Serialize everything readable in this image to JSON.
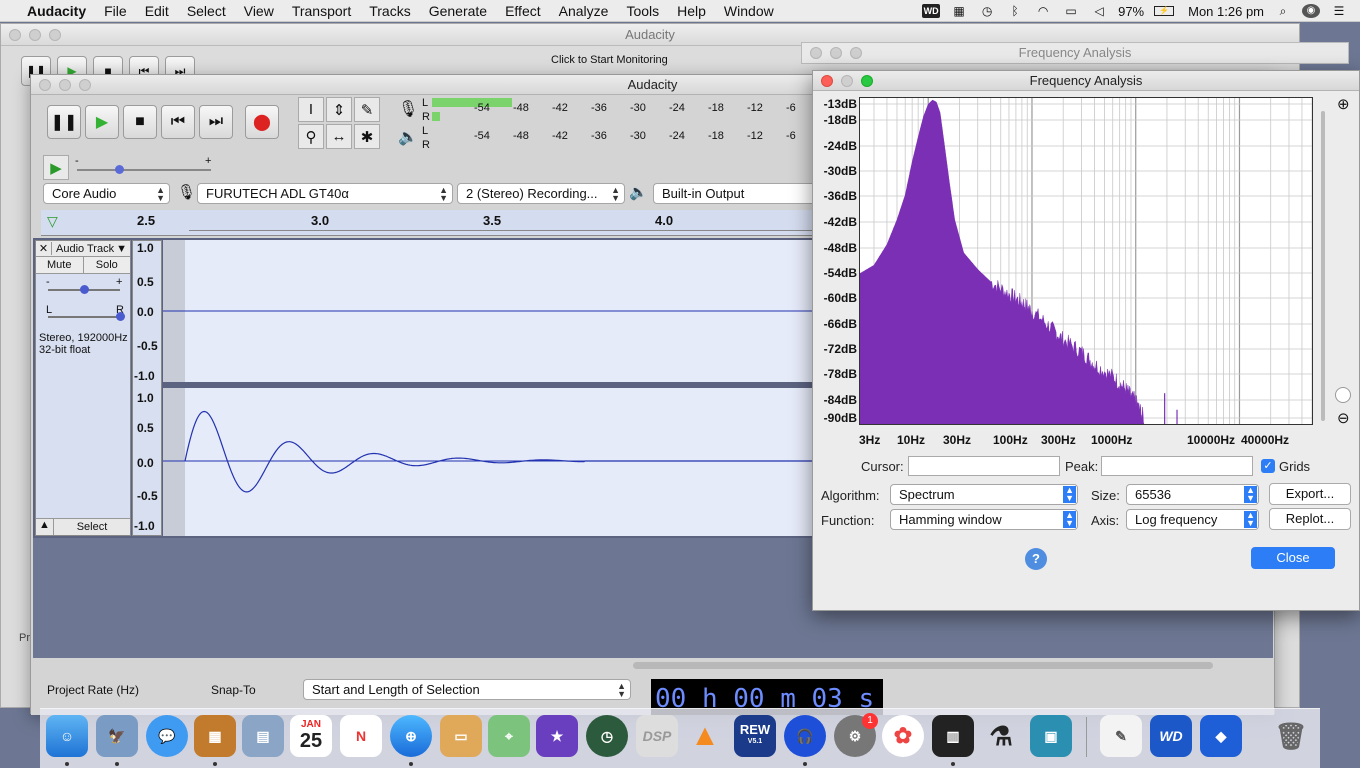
{
  "menubar": {
    "app_name": "Audacity",
    "items": [
      "File",
      "Edit",
      "Select",
      "View",
      "Transport",
      "Tracks",
      "Generate",
      "Effect",
      "Analyze",
      "Tools",
      "Help",
      "Window"
    ],
    "battery": "97%",
    "clock": "Mon 1:26 pm"
  },
  "bg_window": {
    "title": "Audacity",
    "freq_title": "Frequency Analysis",
    "click_monitor": "Click to Start Monitoring"
  },
  "main_window": {
    "title": "Audacity",
    "meter_ticks": [
      "-54",
      "-48",
      "-42",
      "-36",
      "-30",
      "-24",
      "-18",
      "-12",
      "-6"
    ],
    "meter_L": "L",
    "meter_R": "R",
    "playback_ticks_minus": "-",
    "playback_ticks_plus": "+",
    "device": {
      "host": "Core Audio",
      "input": "FURUTECH ADL GT40α",
      "channels": "2 (Stereo) Recording...",
      "output": "Built-in Output"
    },
    "timeline": [
      "2.5",
      "3.0",
      "3.5",
      "4.0"
    ],
    "track": {
      "name": "Audio Track",
      "mute": "Mute",
      "solo": "Solo",
      "gain_minus": "-",
      "gain_plus": "+",
      "pan_l": "L",
      "pan_r": "R",
      "info1": "Stereo, 192000Hz",
      "info2": "32-bit float",
      "select": "Select",
      "scale": [
        "1.0",
        "0.5",
        "0.0",
        "-0.5",
        "-1.0"
      ]
    },
    "bottom": {
      "project_rate_label": "Project Rate (Hz)",
      "snap_to_label": "Snap-To",
      "selection_mode": "Start and Length of Selection",
      "time": "00 h 00 m 03 s"
    }
  },
  "freq_window": {
    "title": "Frequency Analysis",
    "db_labels": [
      "-13dB",
      "-18dB",
      "-24dB",
      "-30dB",
      "-36dB",
      "-42dB",
      "-48dB",
      "-54dB",
      "-60dB",
      "-66dB",
      "-72dB",
      "-78dB",
      "-84dB",
      "-90dB"
    ],
    "hz_labels": [
      "3Hz",
      "10Hz",
      "30Hz",
      "100Hz",
      "300Hz",
      "1000Hz",
      "10000Hz",
      "40000Hz"
    ],
    "cursor_label": "Cursor:",
    "peak_label": "Peak:",
    "grids_label": "Grids",
    "grids_checked": true,
    "algorithm_label": "Algorithm:",
    "algorithm_value": "Spectrum",
    "size_label": "Size:",
    "size_value": "65536",
    "function_label": "Function:",
    "function_value": "Hamming window",
    "axis_label": "Axis:",
    "axis_value": "Log frequency",
    "export_label": "Export...",
    "replot_label": "Replot...",
    "help_label": "?",
    "close_label": "Close",
    "spectrum_color": "#7b2fb5"
  },
  "dock": {
    "calendar_month": "JAN",
    "calendar_day": "25",
    "rew_label": "REW",
    "rew_version": "V5.1",
    "wd_label": "WD",
    "dsp_label": "DSP",
    "badge_count": "1"
  }
}
